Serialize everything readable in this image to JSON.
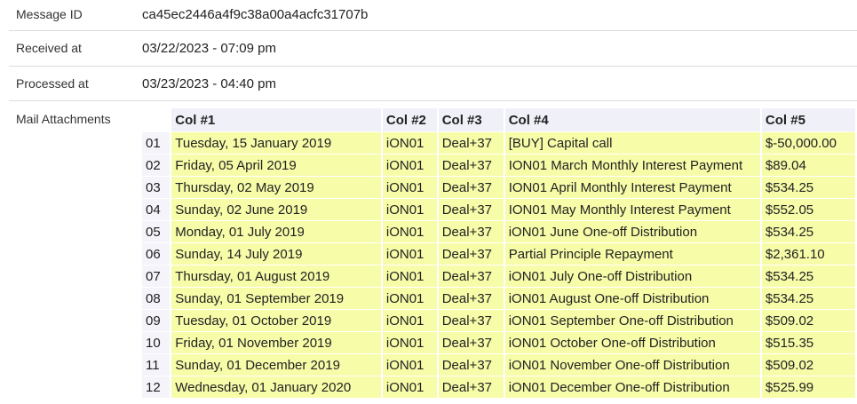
{
  "meta": {
    "message_id": {
      "label": "Message ID",
      "value": "ca45ec2446a4f9c38a00a4acfc31707b"
    },
    "received_at": {
      "label": "Received at",
      "value": "03/22/2023 - 07:09 pm"
    },
    "processed_at": {
      "label": "Processed at",
      "value": "03/23/2023 - 04:40 pm"
    }
  },
  "attachments": {
    "label": "Mail Attachments",
    "columns": [
      "Col #1",
      "Col #2",
      "Col #3",
      "Col #4",
      "Col #5"
    ],
    "rows": [
      {
        "idx": "01",
        "cells": [
          "Tuesday, 15 January 2019",
          "iON01",
          "Deal+37",
          "[BUY] Capital call",
          "$-50,000.00"
        ]
      },
      {
        "idx": "02",
        "cells": [
          "Friday, 05 April 2019",
          "iON01",
          "Deal+37",
          "ION01 March Monthly Interest Payment",
          "$89.04"
        ]
      },
      {
        "idx": "03",
        "cells": [
          "Thursday, 02 May 2019",
          "iON01",
          "Deal+37",
          "ION01 April Monthly Interest Payment",
          "$534.25"
        ]
      },
      {
        "idx": "04",
        "cells": [
          "Sunday, 02 June 2019",
          "iON01",
          "Deal+37",
          "ION01 May Monthly Interest Payment",
          "$552.05"
        ]
      },
      {
        "idx": "05",
        "cells": [
          "Monday, 01 July 2019",
          "iON01",
          "Deal+37",
          "iON01 June One-off Distribution",
          "$534.25"
        ]
      },
      {
        "idx": "06",
        "cells": [
          "Sunday, 14 July 2019",
          "iON01",
          "Deal+37",
          "Partial Principle  Repayment",
          "$2,361.10"
        ]
      },
      {
        "idx": "07",
        "cells": [
          "Thursday, 01 August 2019",
          "iON01",
          "Deal+37",
          "iON01 July One-off Distribution",
          "$534.25"
        ]
      },
      {
        "idx": "08",
        "cells": [
          "Sunday, 01 September 2019",
          "iON01",
          "Deal+37",
          "iON01 August One-off Distribution",
          "$534.25"
        ]
      },
      {
        "idx": "09",
        "cells": [
          "Tuesday, 01 October 2019",
          "iON01",
          "Deal+37",
          "iON01 September One-off Distribution",
          "$509.02"
        ]
      },
      {
        "idx": "10",
        "cells": [
          "Friday, 01 November 2019",
          "iON01",
          "Deal+37",
          "iON01 October One-off Distribution",
          "$515.35"
        ]
      },
      {
        "idx": "11",
        "cells": [
          "Sunday, 01 December 2019",
          "iON01",
          "Deal+37",
          "iON01 November One-off Distribution",
          "$509.02"
        ]
      },
      {
        "idx": "12",
        "cells": [
          "Wednesday, 01 January 2020",
          "iON01",
          "Deal+37",
          "iON01 December One-off Distribution",
          "$525.99"
        ]
      }
    ]
  }
}
